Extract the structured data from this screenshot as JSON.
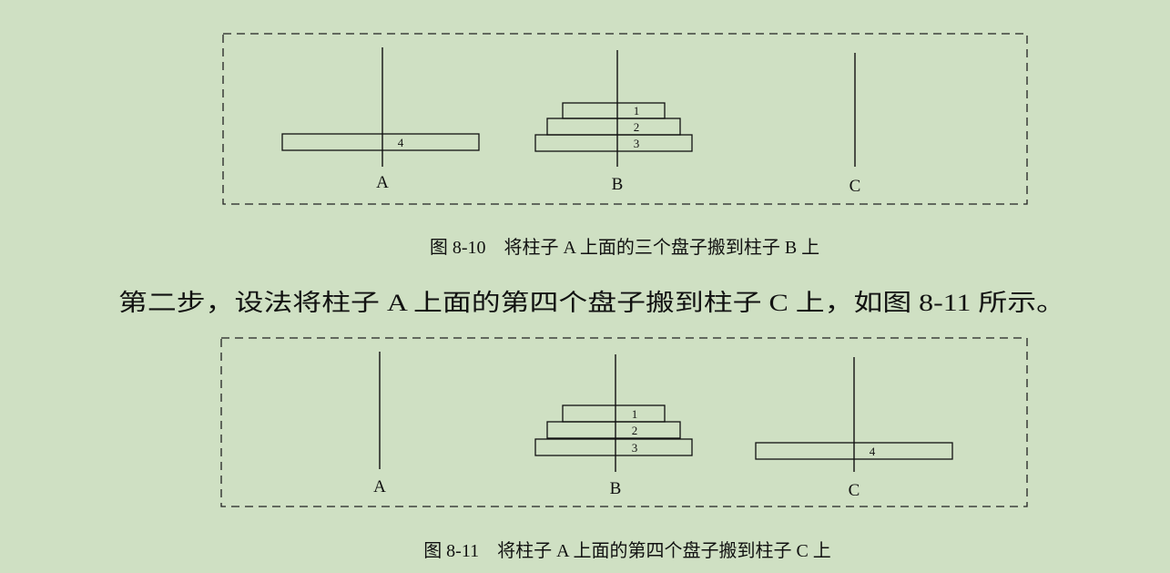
{
  "figures": [
    {
      "pegs": [
        "A",
        "B",
        "C"
      ],
      "disks": [
        {
          "label": "4",
          "peg": "A"
        },
        {
          "label": "1",
          "peg": "B"
        },
        {
          "label": "2",
          "peg": "B"
        },
        {
          "label": "3",
          "peg": "B"
        }
      ],
      "caption": "图 8-10　将柱子 A 上面的三个盘子搬到柱子 B 上"
    },
    {
      "pegs": [
        "A",
        "B",
        "C"
      ],
      "disks": [
        {
          "label": "1",
          "peg": "B"
        },
        {
          "label": "2",
          "peg": "B"
        },
        {
          "label": "3",
          "peg": "B"
        },
        {
          "label": "4",
          "peg": "C"
        }
      ],
      "caption": "图 8-11　将柱子 A 上面的第四个盘子搬到柱子 C 上"
    }
  ],
  "body_text": "第二步，设法将柱子 A 上面的第四个盘子搬到柱子 C 上，如图 8-11 所示。"
}
